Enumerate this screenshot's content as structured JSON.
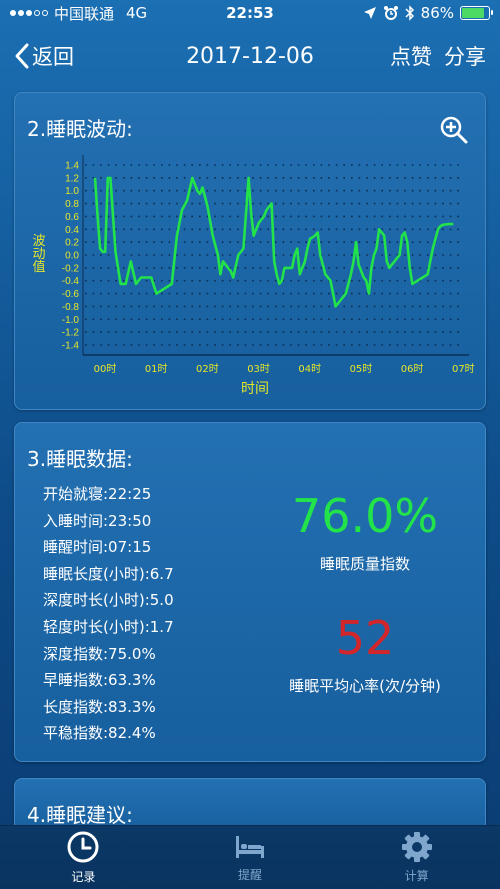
{
  "status_bar": {
    "carrier": "中国联通",
    "network": "4G",
    "time": "22:53",
    "battery_percent": "86%",
    "battery_level": 0.86
  },
  "nav": {
    "back_label": "返回",
    "title": "2017-12-06",
    "like_label": "点赞",
    "share_label": "分享"
  },
  "wave_card": {
    "title": "2.睡眠波动:"
  },
  "chart_data": {
    "type": "line",
    "title": "",
    "xlabel": "时间",
    "ylabel": "波动值",
    "ylim": [
      -1.4,
      1.4
    ],
    "yticks": [
      "1.4",
      "1.2",
      "1.0",
      "0.8",
      "0.6",
      "0.4",
      "0.2",
      "0.0",
      "-0.2",
      "-0.4",
      "-0.6",
      "-0.8",
      "-1.0",
      "-1.2",
      "-1.4"
    ],
    "xticks": [
      "00时",
      "01时",
      "02时",
      "03时",
      "04时",
      "05时",
      "06时",
      "07时"
    ],
    "grid": true,
    "line_color": "#22e34a",
    "axis_text_color": "#e6e628",
    "x": [
      0.0,
      0.05,
      0.1,
      0.15,
      0.2,
      0.25,
      0.3,
      0.4,
      0.5,
      0.55,
      0.6,
      0.7,
      0.8,
      0.9,
      1.0,
      1.1,
      1.2,
      1.3,
      1.4,
      1.5,
      1.6,
      1.7,
      1.8,
      1.9,
      2.0,
      2.05,
      2.1,
      2.15,
      2.2,
      2.3,
      2.4,
      2.45,
      2.5,
      2.55,
      2.6,
      2.65,
      2.7,
      2.8,
      2.9,
      3.0,
      3.05,
      3.1,
      3.15,
      3.2,
      3.25,
      3.3,
      3.35,
      3.4,
      3.45,
      3.5,
      3.55,
      3.6,
      3.65,
      3.7,
      3.75,
      3.8,
      3.85,
      3.9,
      3.95,
      4.0,
      4.05,
      4.1,
      4.15,
      4.2,
      4.3,
      4.35,
      4.4,
      4.45,
      4.5,
      4.6,
      4.7,
      4.8,
      4.9,
      5.0,
      5.05,
      5.1,
      5.15,
      5.2,
      5.25,
      5.3,
      5.35,
      5.4,
      5.45,
      5.5,
      5.55,
      5.6,
      5.65,
      5.7,
      5.75,
      5.8,
      5.85,
      5.9,
      5.95,
      6.0,
      6.05,
      6.1,
      6.15,
      6.2,
      6.3,
      6.4,
      6.5,
      6.6,
      6.7,
      6.75,
      6.8,
      6.9,
      7.0
    ],
    "y": [
      1.2,
      0.6,
      0.1,
      0.05,
      0.05,
      1.2,
      1.2,
      0.05,
      -0.45,
      -0.45,
      -0.45,
      -0.1,
      -0.45,
      -0.35,
      -0.35,
      -0.35,
      -0.6,
      -0.55,
      -0.5,
      -0.45,
      0.3,
      0.7,
      0.85,
      1.2,
      1.0,
      0.95,
      1.05,
      0.9,
      0.75,
      0.3,
      0.0,
      -0.3,
      -0.1,
      -0.15,
      -0.2,
      -0.25,
      -0.35,
      0.0,
      0.1,
      1.2,
      0.65,
      0.3,
      0.4,
      0.5,
      0.55,
      0.6,
      0.7,
      0.75,
      0.8,
      -0.1,
      -0.3,
      -0.45,
      -0.4,
      -0.2,
      -0.2,
      -0.2,
      -0.2,
      0.0,
      0.1,
      -0.3,
      -0.2,
      -0.1,
      0.1,
      0.25,
      0.3,
      0.35,
      0.0,
      -0.15,
      -0.3,
      -0.4,
      -0.8,
      -0.7,
      -0.6,
      -0.3,
      -0.1,
      0.2,
      -0.15,
      -0.25,
      -0.35,
      -0.4,
      -0.6,
      -0.2,
      0.0,
      0.1,
      0.4,
      0.35,
      0.3,
      -0.1,
      -0.2,
      -0.15,
      -0.1,
      -0.05,
      0.0,
      0.3,
      0.35,
      0.2,
      -0.2,
      -0.45,
      -0.4,
      -0.35,
      -0.3,
      0.1,
      0.4,
      0.45,
      0.47,
      0.48,
      0.48
    ]
  },
  "data_card": {
    "title": "3.睡眠数据:",
    "items": [
      "开始就寝:22:25",
      "入睡时间:23:50",
      "睡醒时间:07:15",
      "睡眠长度(小时):6.7",
      "深度时长(小时):5.0",
      "轻度时长(小时):1.7",
      "深度指数:75.0%",
      "早睡指数:63.3%",
      "长度指数:83.3%",
      "平稳指数:82.4%"
    ],
    "quality_value": "76.0%",
    "quality_label": "睡眠质量指数",
    "heart_rate_value": "52",
    "heart_rate_label": "睡眠平均心率(次/分钟)",
    "quality_color": "#22e34a",
    "heart_rate_color": "#d2262a"
  },
  "advice_card": {
    "title": "4.睡眠建议:"
  },
  "tab_bar": {
    "tabs": [
      {
        "label": "记录",
        "icon": "clock-icon",
        "active": true
      },
      {
        "label": "提醒",
        "icon": "bed-icon",
        "active": false
      },
      {
        "label": "计算",
        "icon": "gear-icon",
        "active": false
      }
    ]
  }
}
